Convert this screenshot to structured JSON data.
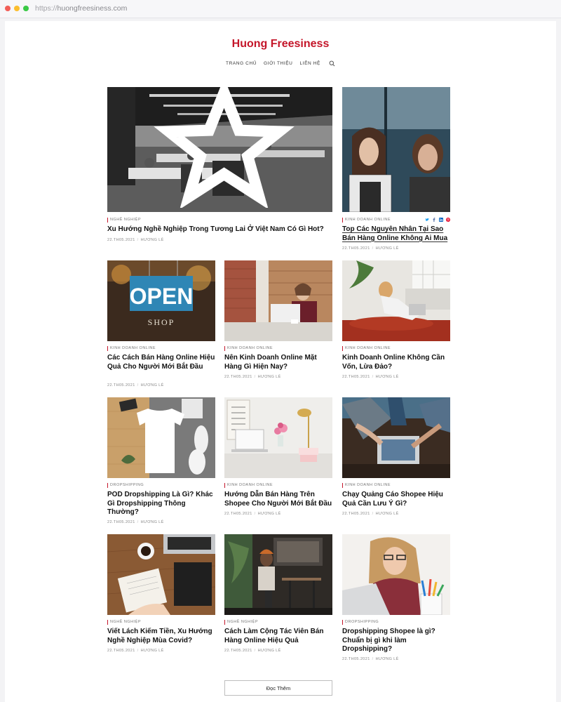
{
  "browser": {
    "url_scheme": "https://",
    "url_host": "huongfreesiness.com"
  },
  "site": {
    "title": "Huong Freesiness"
  },
  "nav": {
    "items": [
      "TRANG CHỦ",
      "GIỚI THIỆU",
      "LIÊN HỆ"
    ]
  },
  "posts": [
    {
      "category": "NGHỀ NGHIỆP",
      "title": "Xu Hướng Nghề Nghiệp Trong Tương Lai Ở Việt Nam Có Gì Hot?",
      "date": "22.TH05.2021",
      "author": "HƯƠNG LÊ"
    },
    {
      "category": "KINH DOANH ONLINE",
      "title": "Top Các Nguyên Nhân Tại Sao Bán Hàng Online Không Ai Mua",
      "date": "22.TH05.2021",
      "author": "HƯƠNG LÊ"
    },
    {
      "category": "KINH DOANH ONLINE",
      "title": "Các Cách Bán Hàng Online Hiệu Quả Cho Người Mới Bắt Đầu",
      "date": "22.TH05.2021",
      "author": "HƯƠNG LÊ"
    },
    {
      "category": "KINH DOANH ONLINE",
      "title": "Nên Kinh Doanh Online Mặt Hàng Gì Hiện Nay?",
      "date": "22.TH05.2021",
      "author": "HƯƠNG LÊ"
    },
    {
      "category": "KINH DOANH ONLINE",
      "title": "Kinh Doanh Online Không Cần Vốn, Lừa Đảo?",
      "date": "22.TH05.2021",
      "author": "HƯƠNG LÊ"
    },
    {
      "category": "DROPSHIPPING",
      "title": "POD Dropshipping Là Gì? Khác Gì Dropshipping Thông Thường?",
      "date": "22.TH05.2021",
      "author": "HƯƠNG LÊ"
    },
    {
      "category": "KINH DOANH ONLINE",
      "title": "Hướng Dẫn Bán Hàng Trên Shopee Cho Người Mới Bắt Đầu",
      "date": "22.TH05.2021",
      "author": "HƯƠNG LÊ"
    },
    {
      "category": "KINH DOANH ONLINE",
      "title": "Chạy Quảng Cáo Shopee Hiệu Quả Cần Lưu Ý Gì?",
      "date": "22.TH05.2021",
      "author": "HƯƠNG LÊ"
    },
    {
      "category": "NGHỀ NGHIỆP",
      "title": "Viết Lách Kiếm Tiền, Xu Hướng Nghề Nghiệp Mùa Covid?",
      "date": "22.TH05.2021",
      "author": "HƯƠNG LÊ"
    },
    {
      "category": "NGHỀ NGHIỆP",
      "title": "Cách Làm Cộng Tác Viên Bán Hàng Online Hiệu Quả",
      "date": "22.TH05.2021",
      "author": "HƯƠNG LÊ"
    },
    {
      "category": "DROPSHIPPING",
      "title": "Dropshipping Shopee là gì? Chuẩn bị gì khi làm Dropshipping?",
      "date": "22.TH05.2021",
      "author": "HƯƠNG LÊ"
    }
  ],
  "sign_text": {
    "open": "OPEN",
    "shop": "SHOP"
  },
  "load_more": {
    "label": "Đọc Thêm"
  },
  "colors": {
    "accent": "#c4162a",
    "twitter": "#1da1f2",
    "facebook": "#3b5998",
    "linkedin": "#0a66c2",
    "pinterest": "#e60023"
  },
  "icons": [
    "search-icon",
    "star-icon",
    "twitter-icon",
    "facebook-icon",
    "linkedin-icon",
    "pinterest-icon"
  ]
}
